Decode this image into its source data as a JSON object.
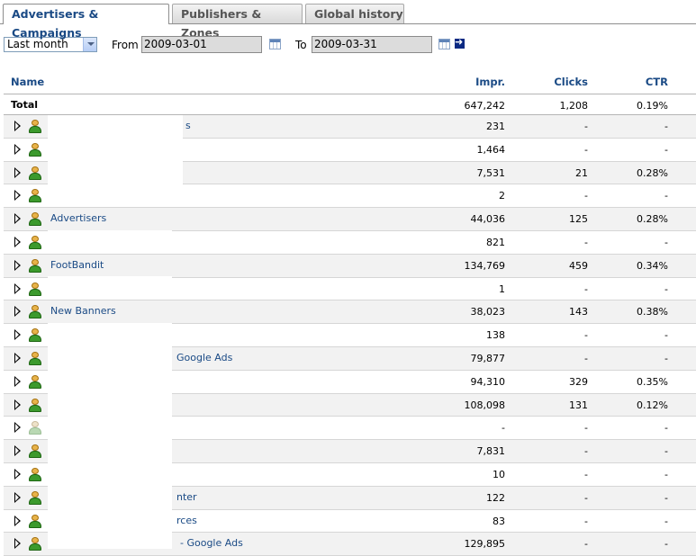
{
  "tabs": [
    {
      "label": "Advertisers & Campaigns",
      "active": true
    },
    {
      "label": "Publishers & Zones",
      "active": false
    },
    {
      "label": "Global history",
      "active": false
    }
  ],
  "controls": {
    "period": "Last month",
    "from_label": "From",
    "from_value": "2009-03-01",
    "to_label": "To",
    "to_value": "2009-03-31"
  },
  "table": {
    "headers": {
      "name": "Name",
      "impr": "Impr.",
      "clicks": "Clicks",
      "ctr": "CTR"
    },
    "total": {
      "name": "Total",
      "impr": "647,242",
      "clicks": "1,208",
      "ctr": "0.19%"
    },
    "rows": [
      {
        "name": "s",
        "impr": "231",
        "clicks": "-",
        "ctr": "-",
        "active": true
      },
      {
        "name": "",
        "impr": "1,464",
        "clicks": "-",
        "ctr": "-",
        "active": true
      },
      {
        "name": "",
        "impr": "7,531",
        "clicks": "21",
        "ctr": "0.28%",
        "active": true
      },
      {
        "name": "",
        "impr": "2",
        "clicks": "-",
        "ctr": "-",
        "active": true
      },
      {
        "name": "Advertisers",
        "impr": "44,036",
        "clicks": "125",
        "ctr": "0.28%",
        "active": true
      },
      {
        "name": "",
        "impr": "821",
        "clicks": "-",
        "ctr": "-",
        "active": true
      },
      {
        "name": "FootBandit",
        "impr": "134,769",
        "clicks": "459",
        "ctr": "0.34%",
        "active": true
      },
      {
        "name": "",
        "impr": "1",
        "clicks": "-",
        "ctr": "-",
        "active": true
      },
      {
        "name": "New Banners",
        "impr": "38,023",
        "clicks": "143",
        "ctr": "0.38%",
        "active": true
      },
      {
        "name": "",
        "impr": "138",
        "clicks": "-",
        "ctr": "-",
        "active": true
      },
      {
        "name": "Google Ads",
        "impr": "79,877",
        "clicks": "-",
        "ctr": "-",
        "active": true
      },
      {
        "name": "",
        "impr": "94,310",
        "clicks": "329",
        "ctr": "0.35%",
        "active": true
      },
      {
        "name": "",
        "impr": "108,098",
        "clicks": "131",
        "ctr": "0.12%",
        "active": true
      },
      {
        "name": "",
        "impr": "-",
        "clicks": "-",
        "ctr": "-",
        "active": false
      },
      {
        "name": "",
        "impr": "7,831",
        "clicks": "-",
        "ctr": "-",
        "active": true
      },
      {
        "name": "",
        "impr": "10",
        "clicks": "-",
        "ctr": "-",
        "active": true
      },
      {
        "name": "nter",
        "impr": "122",
        "clicks": "-",
        "ctr": "-",
        "active": true
      },
      {
        "name": "rces",
        "impr": "83",
        "clicks": "-",
        "ctr": "-",
        "active": true
      },
      {
        "name": "- Google Ads",
        "impr": "129,895",
        "clicks": "-",
        "ctr": "-",
        "active": true
      }
    ]
  }
}
